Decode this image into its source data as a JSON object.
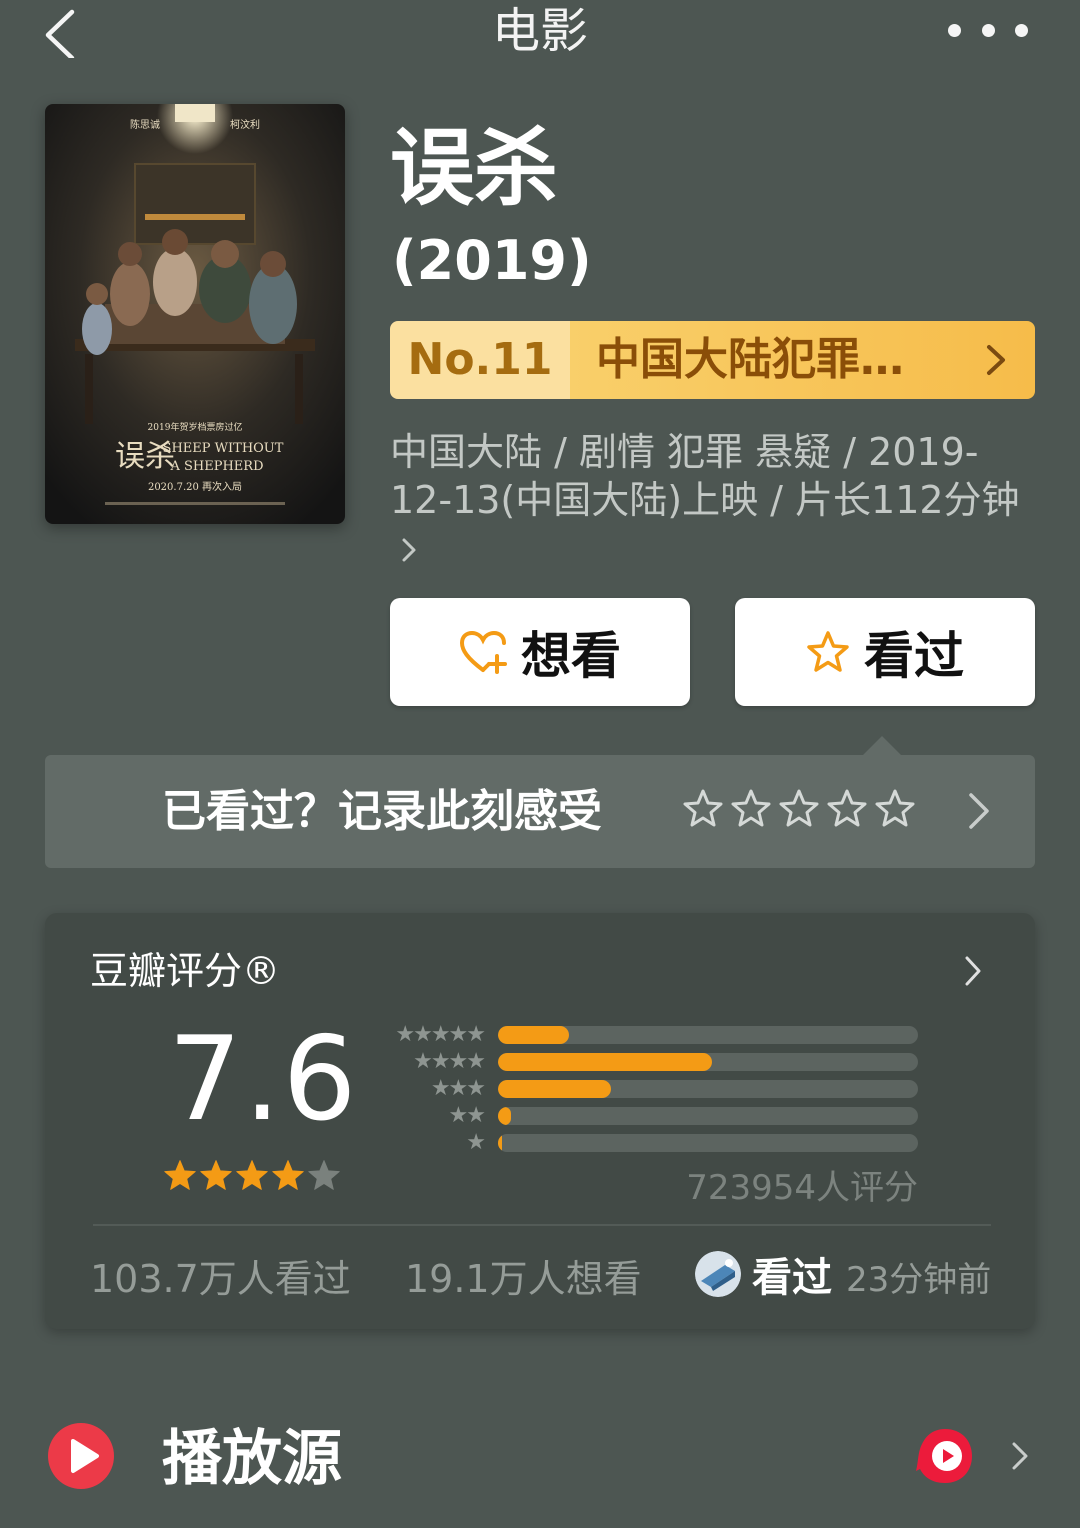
{
  "nav": {
    "title": "电影"
  },
  "movie": {
    "title": "误杀",
    "year": "(2019)",
    "meta": "中国大陆 / 剧情 犯罪 悬疑 / 2019-12-13(中国大陆)上映 / 片长112分钟",
    "poster_text": {
      "actor_left": "陈思诚",
      "actor_right": "柯汶利",
      "tagline": "2019年贺岁档票房过亿",
      "title_cn": "误杀",
      "title_en_1": "SHEEP WITHOUT",
      "title_en_2": "A SHEPHERD",
      "date": "2020.7.20  再次入局"
    }
  },
  "rank": {
    "number": "No.11",
    "category": "中国大陆犯罪…"
  },
  "actions": {
    "want_label": "想看",
    "watched_label": "看过"
  },
  "rate_prompt": {
    "text": "已看过？记录此刻感受",
    "star_count": 5
  },
  "score": {
    "label": "豆瓣评分®",
    "value": "7.6",
    "stars": 4,
    "distribution": [
      {
        "stars": "★★★★★",
        "fraction": 0.17
      },
      {
        "stars": "★★★★",
        "fraction": 0.51
      },
      {
        "stars": "★★★",
        "fraction": 0.27
      },
      {
        "stars": "★★",
        "fraction": 0.03
      },
      {
        "stars": "★",
        "fraction": 0.005
      }
    ],
    "rating_count": "723954人评分",
    "watched_count": "103.7万人看过",
    "wish_count": "19.1万人想看",
    "friend_action": "看过",
    "friend_time": "23分钟前"
  },
  "play": {
    "title": "播放源"
  },
  "colors": {
    "background": "#4d5652",
    "accent_orange": "#f49b15",
    "rank_badge": "#f7c454",
    "play_red": "#ec3a48"
  }
}
